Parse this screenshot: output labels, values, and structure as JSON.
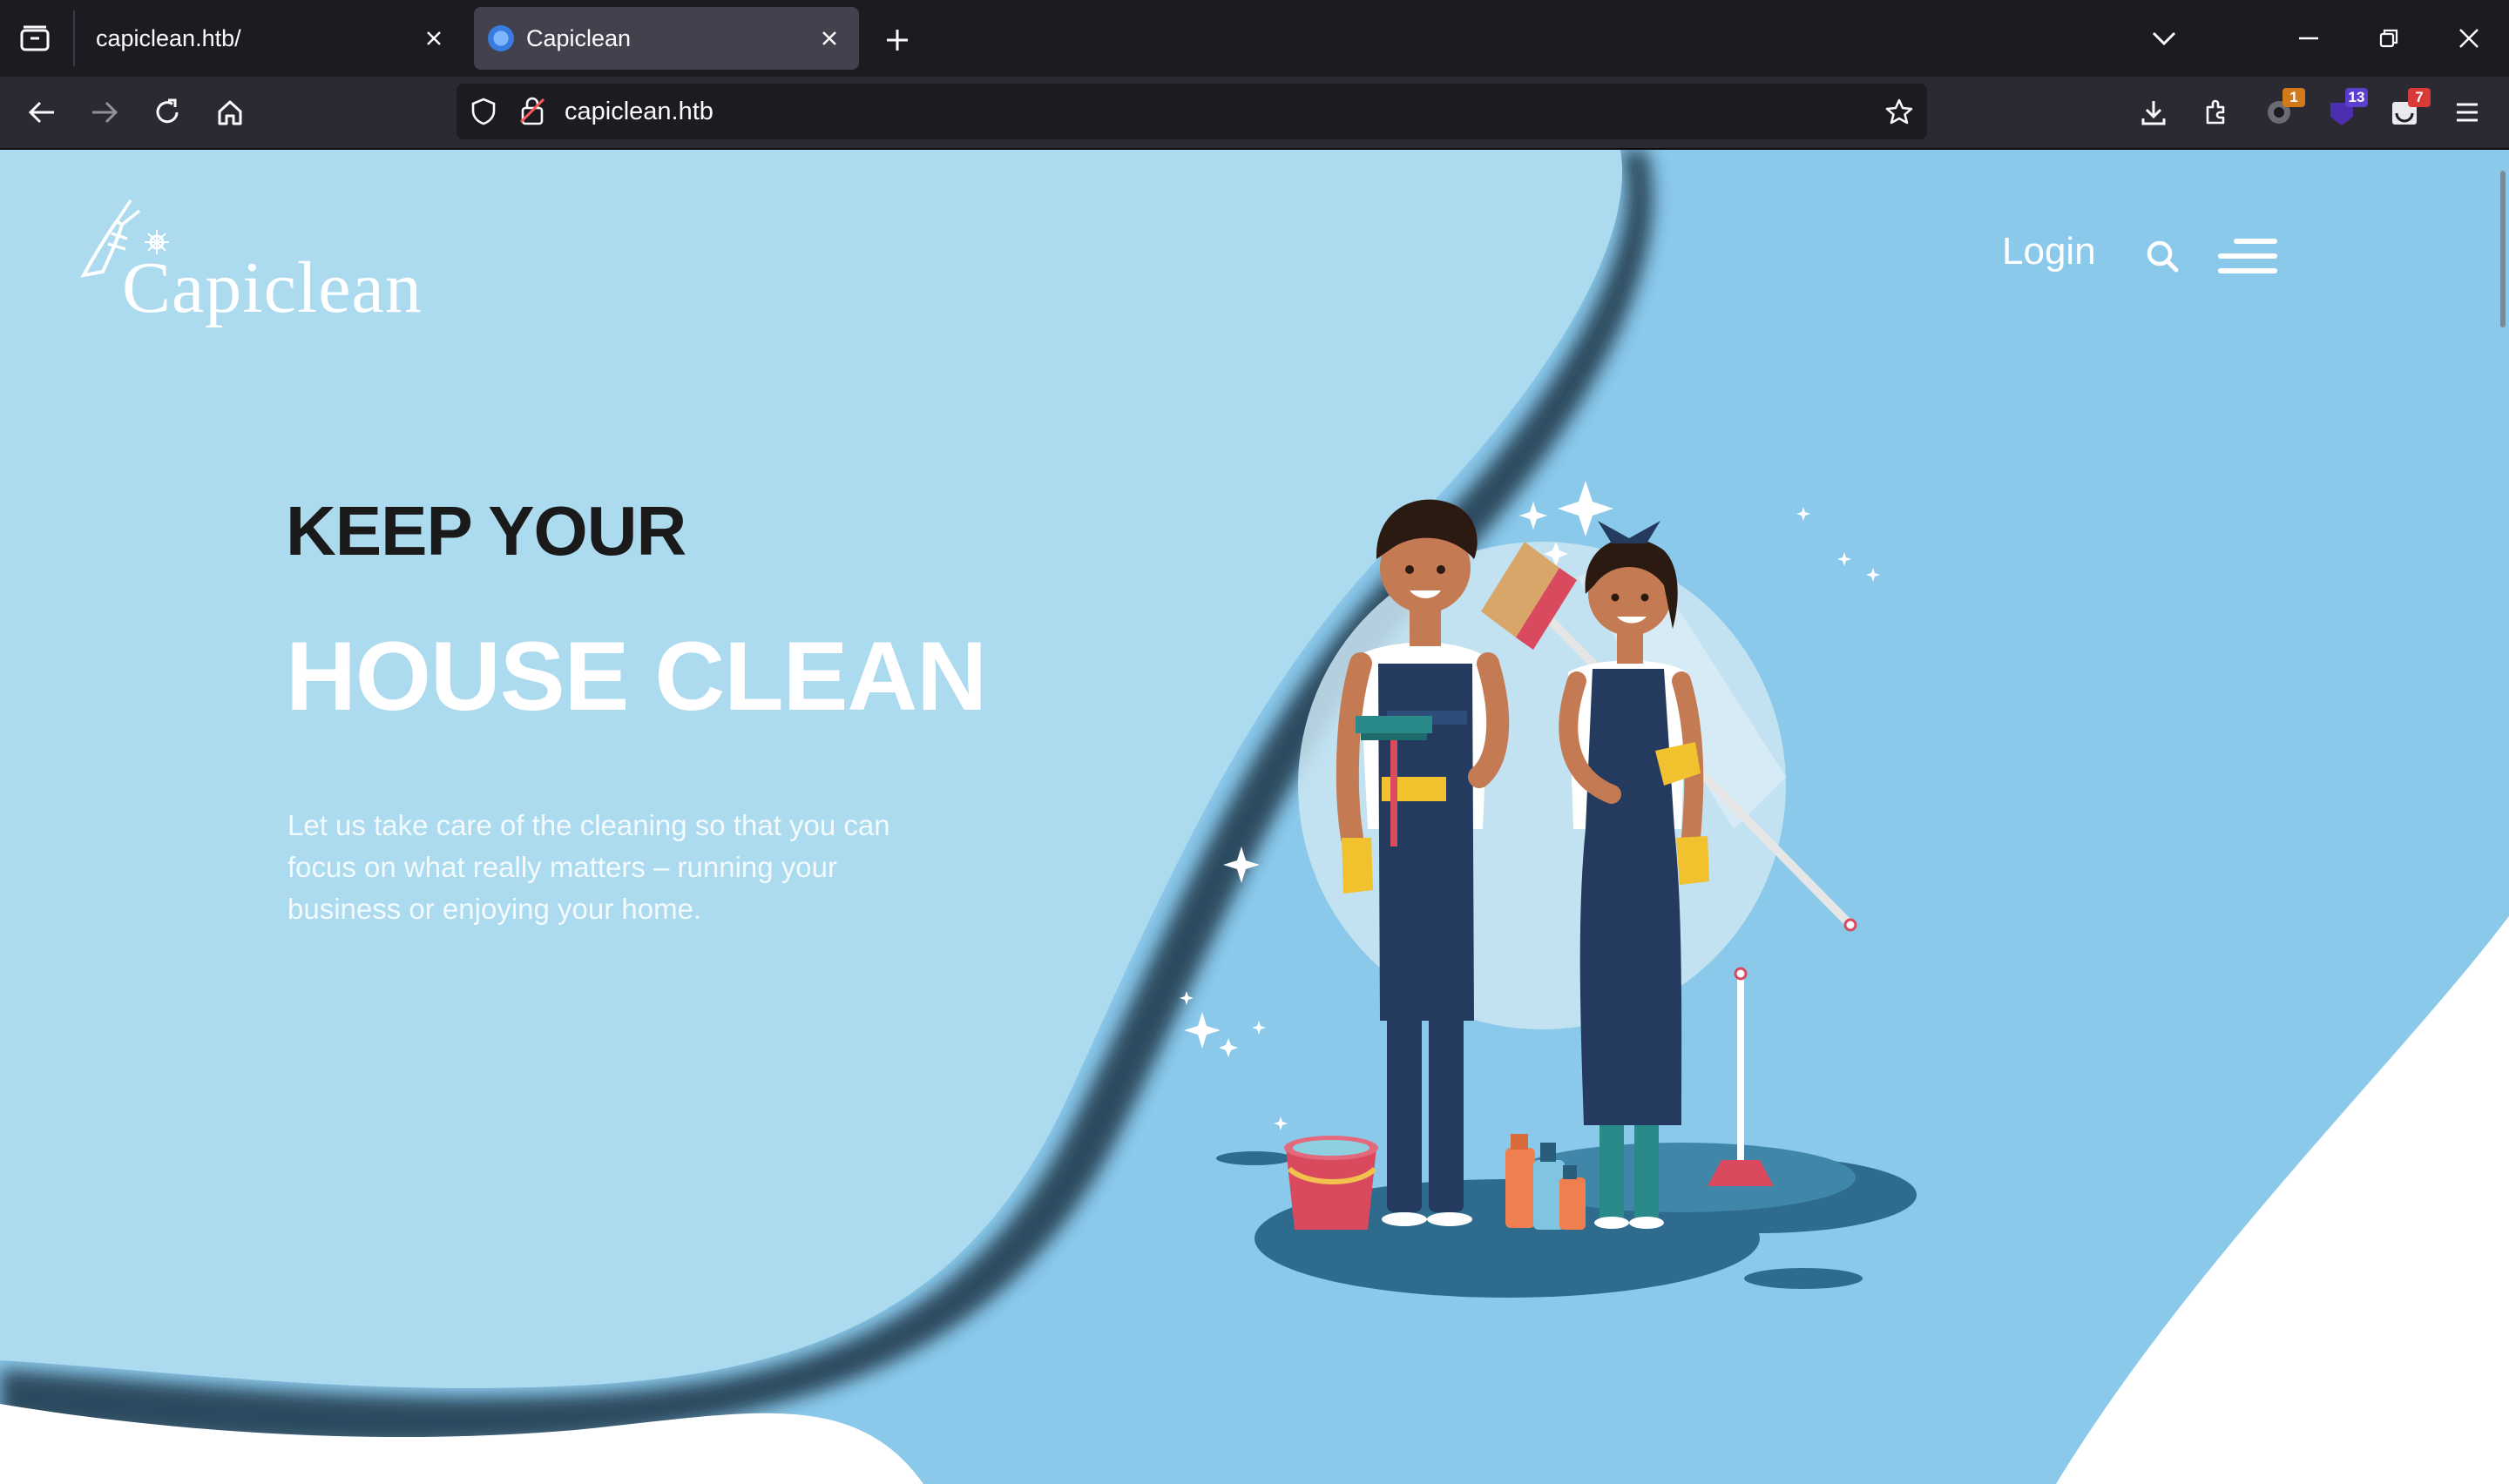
{
  "browser": {
    "tabs": [
      {
        "title": "capiclean.htb/",
        "active": false
      },
      {
        "title": "Capiclean",
        "active": true
      }
    ],
    "url": "capiclean.htb",
    "extension_badges": [
      "1",
      "13",
      "7"
    ]
  },
  "site": {
    "logo_text": "Capiclean",
    "nav": {
      "login_label": "Login"
    },
    "hero": {
      "subtitle": "KEEP YOUR",
      "title": "HOUSE CLEAN",
      "description": "Let us take care of the cleaning so that you can focus on what really matters – running your business or enjoying your home."
    }
  },
  "colors": {
    "left_panel": "#acdaee",
    "right_panel": "#8bc9eb",
    "wave_shadow": "#1f3447",
    "accent_dark": "#1e3a56"
  },
  "icons": [
    "tab-list-icon",
    "close-icon",
    "new-tab-icon",
    "chevron-down-icon",
    "minimize-icon",
    "restore-icon",
    "back-icon",
    "forward-icon",
    "reload-icon",
    "home-icon",
    "shield-icon",
    "lock-icon",
    "star-icon",
    "download-icon",
    "extensions-icon",
    "menu-icon",
    "search-icon",
    "hamburger-icon",
    "broom-logo-icon"
  ]
}
